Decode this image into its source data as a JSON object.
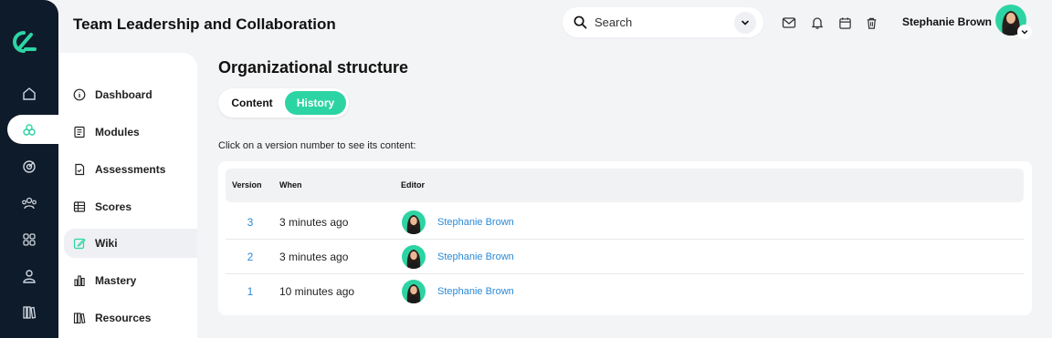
{
  "app": {
    "title": "Team Leadership and Collaboration"
  },
  "header": {
    "search_placeholder": "Search",
    "user_name": "Stephanie Brown"
  },
  "rail": {
    "items": [
      "home-icon",
      "modules-icon",
      "target-icon",
      "people-icon",
      "grid-icon",
      "user-icon",
      "library-icon"
    ],
    "active_index": 1
  },
  "subnav": {
    "items": [
      {
        "label": "Dashboard",
        "icon": "info-icon"
      },
      {
        "label": "Modules",
        "icon": "book-icon"
      },
      {
        "label": "Assessments",
        "icon": "document-icon"
      },
      {
        "label": "Scores",
        "icon": "table-icon"
      },
      {
        "label": "Wiki",
        "icon": "edit-icon",
        "active": true
      },
      {
        "label": "Mastery",
        "icon": "bar-chart-icon"
      },
      {
        "label": "Resources",
        "icon": "books-icon"
      }
    ]
  },
  "main": {
    "title": "Organizational structure",
    "tabs": [
      {
        "label": "Content",
        "active": false
      },
      {
        "label": "History",
        "active": true
      }
    ],
    "hint": "Click on a version number to see its content:",
    "table": {
      "headers": {
        "version": "Version",
        "when": "When",
        "editor": "Editor"
      },
      "rows": [
        {
          "version": "3",
          "when": "3 minutes ago",
          "editor": "Stephanie Brown"
        },
        {
          "version": "2",
          "when": "3 minutes ago",
          "editor": "Stephanie Brown"
        },
        {
          "version": "1",
          "when": "10 minutes ago",
          "editor": "Stephanie Brown"
        }
      ]
    }
  },
  "colors": {
    "accent": "#2dd4a3",
    "rail_bg": "#0d1b2a",
    "link": "#2b8ad8"
  }
}
